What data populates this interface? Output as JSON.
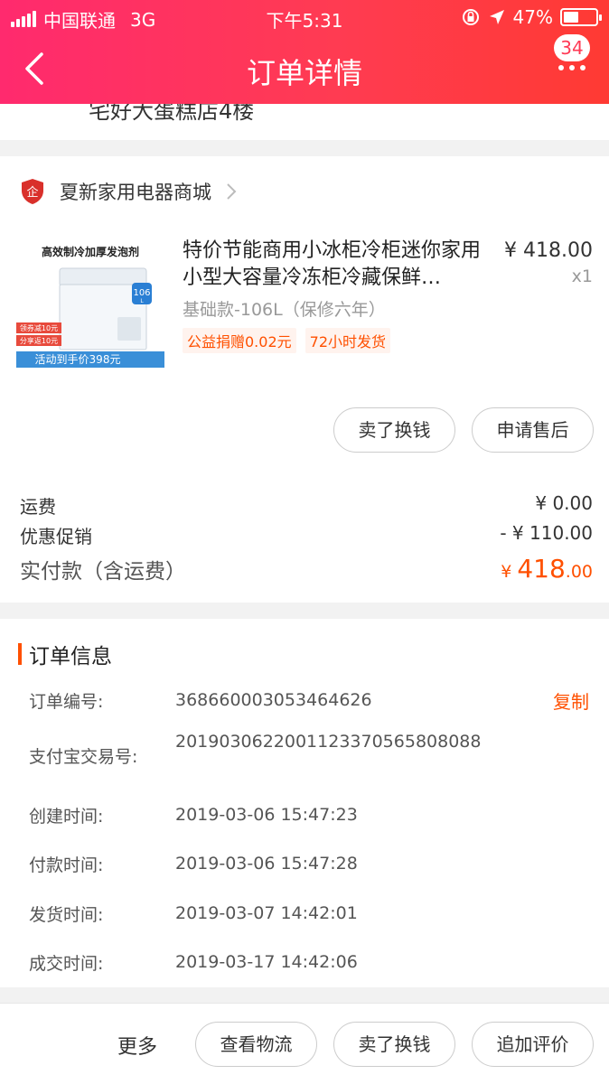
{
  "status_bar": {
    "carrier": "中国联通",
    "network": "3G",
    "time": "下午5:31",
    "battery_pct": "47%",
    "battery_level": 0.47
  },
  "nav": {
    "title": "订单详情",
    "badge_count": "34"
  },
  "address_cutoff": "宅好大蛋糕店4楼",
  "shop": {
    "name": "夏新家用电器商城",
    "logo_icon": "enterprise-shield-icon",
    "logo_char": "企"
  },
  "product": {
    "title": "特价节能商用小冰柜冷柜迷你家用小型大容量冷冻柜冷藏保鲜…",
    "price": "¥ 418.00",
    "qty": "x1",
    "spec": "基础款-106L（保修六年）",
    "tags": [
      "公益捐赠0.02元",
      "72小时发货"
    ],
    "image_text": {
      "headline": "高效制冷加厚发泡剂",
      "capacity": "106",
      "capacity_unit": "L",
      "coupon1": "领券减10元",
      "coupon2": "分享返10元",
      "banner": "活动到手价398元"
    }
  },
  "item_actions": {
    "resell": "卖了换钱",
    "after_sale": "申请售后"
  },
  "fees": {
    "shipping_label": "运费",
    "shipping_value": "¥ 0.00",
    "promo_label": "优惠促销",
    "promo_value": "- ¥ 110.00",
    "total_label": "实付款（含运费）",
    "total_currency": "¥ ",
    "total_int": "418",
    "total_dec": ".00"
  },
  "order_info": {
    "title": "订单信息",
    "copy_label": "复制",
    "rows": [
      {
        "label": "订单编号:",
        "value": "368660003053464626"
      },
      {
        "label": "支付宝交易号:",
        "value": "2019030622001123370565808088"
      },
      {
        "label": "创建时间:",
        "value": "2019-03-06 15:47:23"
      },
      {
        "label": "付款时间:",
        "value": "2019-03-06 15:47:28"
      },
      {
        "label": "发货时间:",
        "value": "2019-03-07 14:42:01"
      },
      {
        "label": "成交时间:",
        "value": "2019-03-17 14:42:06"
      }
    ]
  },
  "bottom_bar": {
    "more": "更多",
    "logistics": "查看物流",
    "resell": "卖了换钱",
    "review": "追加评价"
  },
  "colors": {
    "header_start": "#ff2a6e",
    "header_end": "#ff3a33",
    "accent_orange": "#ff5000",
    "shop_logo_red": "#d9302b"
  }
}
